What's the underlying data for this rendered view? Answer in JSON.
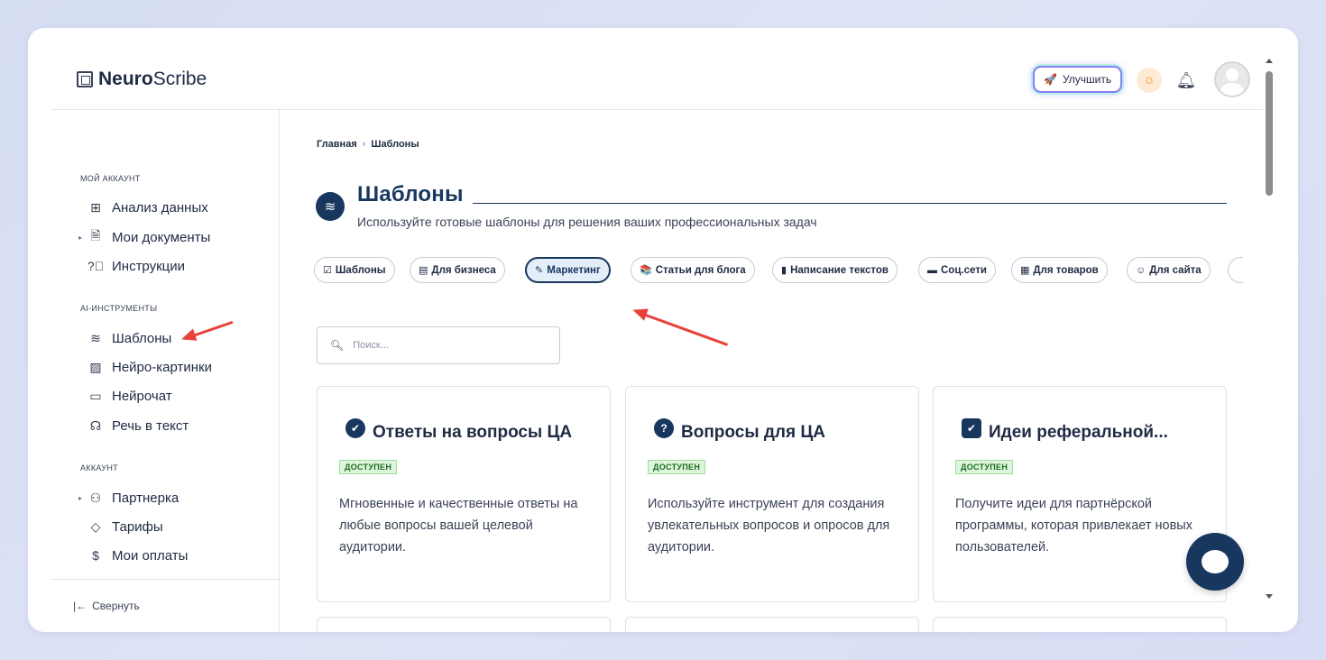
{
  "app": {
    "logo_bold": "Neuro",
    "logo_rest": "Scribe"
  },
  "header": {
    "upgrade_label": "Улучшить"
  },
  "sidebar": {
    "sections": [
      {
        "title": "МОЙ АККАУНТ",
        "items": [
          {
            "label": "Анализ данных",
            "icon": "grid-icon"
          },
          {
            "label": "Мои документы",
            "icon": "document-icon",
            "expandable": true
          },
          {
            "label": "Инструкции",
            "icon": "help-icon"
          }
        ]
      },
      {
        "title": "AI-ИНСТРУМЕНТЫ",
        "items": [
          {
            "label": "Шаблоны",
            "icon": "layers-icon"
          },
          {
            "label": "Нейро-картинки",
            "icon": "image-icon"
          },
          {
            "label": "Нейрочат",
            "icon": "chat-icon"
          },
          {
            "label": "Речь в текст",
            "icon": "headphones-icon"
          }
        ]
      },
      {
        "title": "АККАУНТ",
        "items": [
          {
            "label": "Партнерка",
            "icon": "users-icon",
            "expandable": true
          },
          {
            "label": "Тарифы",
            "icon": "tag-icon"
          },
          {
            "label": "Мои оплаты",
            "icon": "dollar-icon"
          }
        ]
      }
    ],
    "collapse_label": "Свернуть"
  },
  "breadcrumb": {
    "home": "Главная",
    "current": "Шаблоны"
  },
  "page": {
    "title": "Шаблоны",
    "subtitle": "Используйте готовые шаблоны для решения ваших профессиональных задач"
  },
  "categories": [
    {
      "label": "Шаблоны",
      "icon": "☑"
    },
    {
      "label": "Для бизнеса",
      "icon": "▤"
    },
    {
      "label": "Маркетинг",
      "icon": "📝",
      "active": true
    },
    {
      "label": "Статьи для блога",
      "icon": "📚"
    },
    {
      "label": "Написание текстов",
      "icon": "▮"
    },
    {
      "label": "Соц.сети",
      "icon": "▬"
    },
    {
      "label": "Для товаров",
      "icon": "▦"
    },
    {
      "label": "Для сайта",
      "icon": "☺"
    }
  ],
  "search": {
    "placeholder": "Поиск..."
  },
  "cards": [
    {
      "title": "Ответы на вопросы ЦА",
      "badge": "ДОСТУПЕН",
      "icon": "✔",
      "description": "Мгновенные и качественные ответы на любые вопросы вашей целевой аудитории."
    },
    {
      "title": "Вопросы для ЦА",
      "badge": "ДОСТУПЕН",
      "icon": "?",
      "description": "Используйте инструмент для создания увлекательных вопросов и опросов для аудитории."
    },
    {
      "title": "Идеи реферальной...",
      "badge": "ДОСТУПЕН",
      "icon": "✔",
      "description": "Получите идеи для партнёрской программы, которая привлекает новых пользователей."
    }
  ],
  "colors": {
    "accent": "#17375e",
    "annotation_arrow": "#e8413b",
    "badge_bg": "#dcf5dc"
  }
}
